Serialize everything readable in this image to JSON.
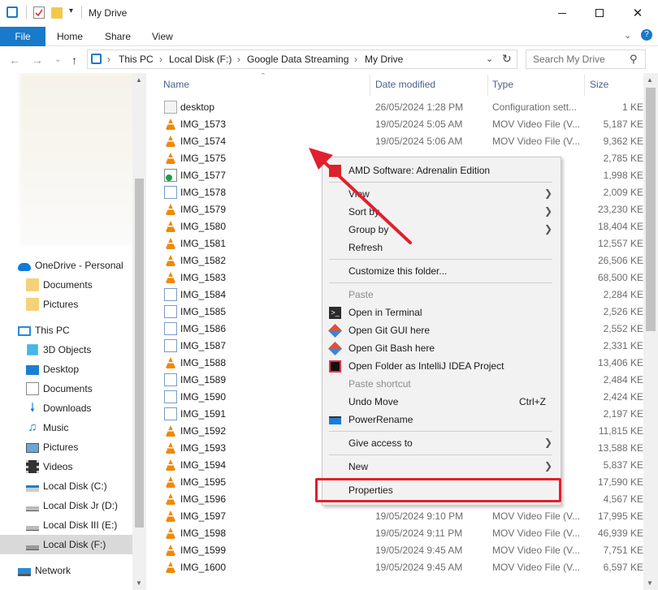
{
  "window": {
    "title": "My Drive"
  },
  "ribbon": {
    "file": "File",
    "tabs": [
      "Home",
      "Share",
      "View"
    ]
  },
  "address": {
    "crumbs": [
      "This PC",
      "Local Disk (F:)",
      "Google Data Streaming",
      "My Drive"
    ],
    "search_placeholder": "Search My Drive"
  },
  "nav": {
    "onedrive": "OneDrive - Personal",
    "onedrive_items": [
      "Documents",
      "Pictures"
    ],
    "thispc": "This PC",
    "pc_items": [
      "3D Objects",
      "Desktop",
      "Documents",
      "Downloads",
      "Music",
      "Pictures",
      "Videos",
      "Local Disk (C:)",
      "Local Disk Jr (D:)",
      "Local Disk III (E:)",
      "Local Disk (F:)"
    ],
    "network": "Network"
  },
  "columns": {
    "name": "Name",
    "date": "Date modified",
    "type": "Type",
    "size": "Size"
  },
  "files": [
    {
      "name": "desktop",
      "date": "26/05/2024 1:28 PM",
      "type": "Configuration sett...",
      "size": "1 KE",
      "icon": "settings-file-icon"
    },
    {
      "name": "IMG_1573",
      "date": "19/05/2024 5:05 AM",
      "type": "MOV Video File (V...",
      "size": "5,187 KE",
      "icon": "vlc-icon"
    },
    {
      "name": "IMG_1574",
      "date": "19/05/2024 5:06 AM",
      "type": "MOV Video File (V...",
      "size": "9,362 KE",
      "icon": "vlc-icon"
    },
    {
      "name": "IMG_1575",
      "date": "",
      "type": "",
      "size": "2,785 KE",
      "icon": "vlc-icon"
    },
    {
      "name": "IMG_1577",
      "date": "",
      "type": "",
      "size": "1,998 KE",
      "icon": "sync-file-icon"
    },
    {
      "name": "IMG_1578",
      "date": "",
      "type": "",
      "size": "2,009 KE",
      "icon": "image-file-icon"
    },
    {
      "name": "IMG_1579",
      "date": "",
      "type": "",
      "size": "23,230 KE",
      "icon": "vlc-icon"
    },
    {
      "name": "IMG_1580",
      "date": "",
      "type": "",
      "size": "18,404 KE",
      "icon": "vlc-icon"
    },
    {
      "name": "IMG_1581",
      "date": "",
      "type": "",
      "size": "12,557 KE",
      "icon": "vlc-icon"
    },
    {
      "name": "IMG_1582",
      "date": "",
      "type": "",
      "size": "26,506 KE",
      "icon": "vlc-icon"
    },
    {
      "name": "IMG_1583",
      "date": "",
      "type": "",
      "size": "68,500 KE",
      "icon": "vlc-icon"
    },
    {
      "name": "IMG_1584",
      "date": "",
      "type": "",
      "size": "2,284 KE",
      "icon": "image-file-icon"
    },
    {
      "name": "IMG_1585",
      "date": "",
      "type": "",
      "size": "2,526 KE",
      "icon": "image-file-icon"
    },
    {
      "name": "IMG_1586",
      "date": "",
      "type": "",
      "size": "2,552 KE",
      "icon": "image-file-icon"
    },
    {
      "name": "IMG_1587",
      "date": "",
      "type": "",
      "size": "2,331 KE",
      "icon": "image-file-icon"
    },
    {
      "name": "IMG_1588",
      "date": "",
      "type": "",
      "size": "13,406 KE",
      "icon": "vlc-icon"
    },
    {
      "name": "IMG_1589",
      "date": "",
      "type": "",
      "size": "2,484 KE",
      "icon": "image-file-icon"
    },
    {
      "name": "IMG_1590",
      "date": "",
      "type": "",
      "size": "2,424 KE",
      "icon": "image-file-icon"
    },
    {
      "name": "IMG_1591",
      "date": "",
      "type": "",
      "size": "2,197 KE",
      "icon": "image-file-icon"
    },
    {
      "name": "IMG_1592",
      "date": "",
      "type": "",
      "size": "11,815 KE",
      "icon": "vlc-icon"
    },
    {
      "name": "IMG_1593",
      "date": "",
      "type": "",
      "size": "13,588 KE",
      "icon": "vlc-icon"
    },
    {
      "name": "IMG_1594",
      "date": "",
      "type": "",
      "size": "5,837 KE",
      "icon": "vlc-icon"
    },
    {
      "name": "IMG_1595",
      "date": "",
      "type": "",
      "size": "17,590 KE",
      "icon": "vlc-icon"
    },
    {
      "name": "IMG_1596",
      "date": "",
      "type": "",
      "size": "4,567 KE",
      "icon": "vlc-icon"
    },
    {
      "name": "IMG_1597",
      "date": "19/05/2024 9:10 PM",
      "type": "MOV Video File (V...",
      "size": "17,995 KE",
      "icon": "vlc-icon"
    },
    {
      "name": "IMG_1598",
      "date": "19/05/2024 9:11 PM",
      "type": "MOV Video File (V...",
      "size": "46,939 KE",
      "icon": "vlc-icon"
    },
    {
      "name": "IMG_1599",
      "date": "19/05/2024 9:45 AM",
      "type": "MOV Video File (V...",
      "size": "7,751 KE",
      "icon": "vlc-icon"
    },
    {
      "name": "IMG_1600",
      "date": "19/05/2024 9:45 AM",
      "type": "MOV Video File (V...",
      "size": "6,597 KE",
      "icon": "vlc-icon"
    }
  ],
  "context_menu": {
    "amd": "AMD Software: Adrenalin Edition",
    "view": "View",
    "sort_by": "Sort by",
    "group_by": "Group by",
    "refresh": "Refresh",
    "customize": "Customize this folder...",
    "paste": "Paste",
    "open_terminal": "Open in Terminal",
    "git_gui": "Open Git GUI here",
    "git_bash": "Open Git Bash here",
    "intellij": "Open Folder as IntelliJ IDEA Project",
    "paste_shortcut": "Paste shortcut",
    "undo_move": "Undo Move",
    "undo_shortcut": "Ctrl+Z",
    "power_rename": "PowerRename",
    "give_access": "Give access to",
    "new": "New",
    "properties": "Properties"
  },
  "colors": {
    "accent": "#1979ca",
    "highlight": "#e0202e"
  }
}
